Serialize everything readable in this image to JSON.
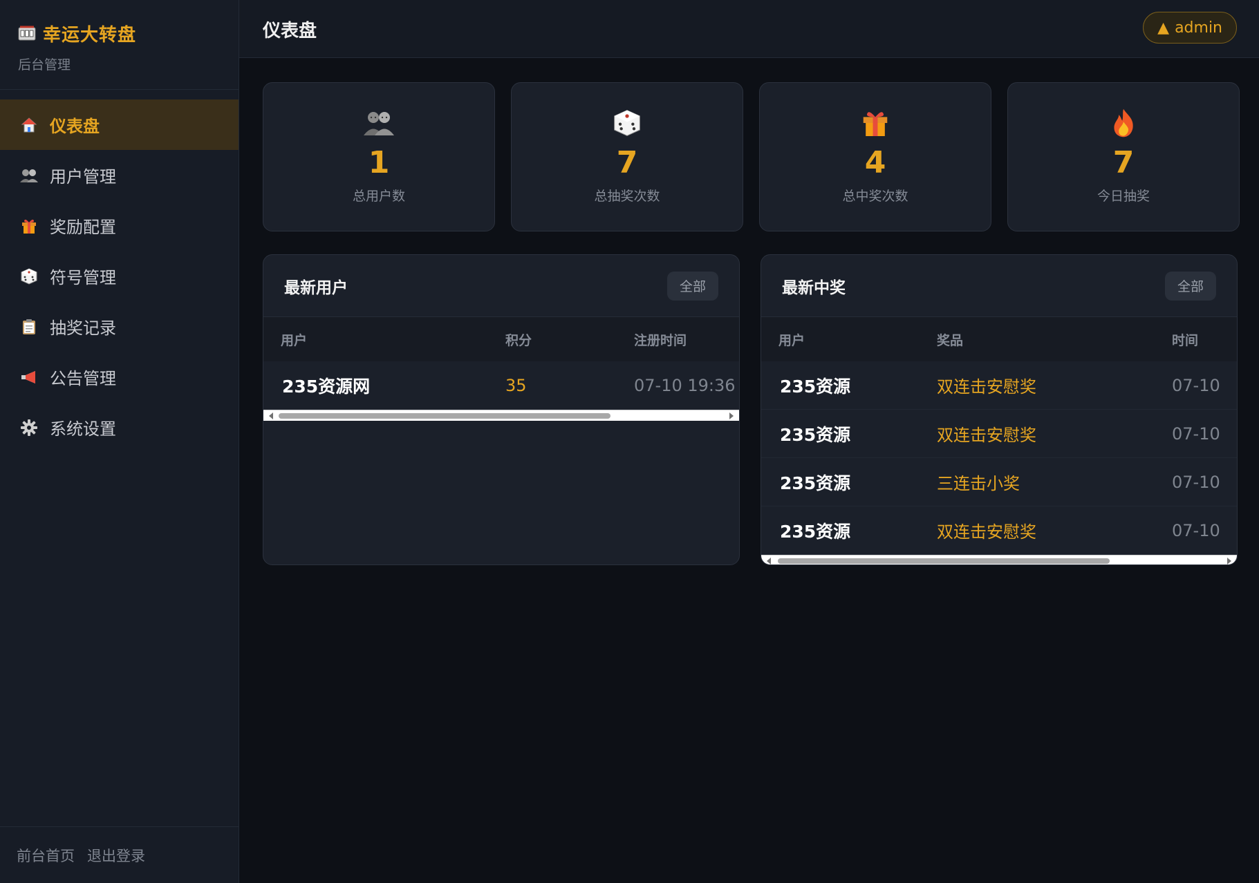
{
  "brand": {
    "title": "幸运大转盘",
    "subtitle": "后台管理",
    "icon": "slot-machine-icon"
  },
  "nav": {
    "items": [
      {
        "label": "仪表盘",
        "icon": "house-icon",
        "active": true
      },
      {
        "label": "用户管理",
        "icon": "users-icon"
      },
      {
        "label": "奖励配置",
        "icon": "gift-icon"
      },
      {
        "label": "符号管理",
        "icon": "dice-icon"
      },
      {
        "label": "抽奖记录",
        "icon": "clipboard-icon"
      },
      {
        "label": "公告管理",
        "icon": "megaphone-icon"
      },
      {
        "label": "系统设置",
        "icon": "gear-icon"
      }
    ]
  },
  "footer": {
    "home": "前台首页",
    "logout": "退出登录"
  },
  "header": {
    "title": "仪表盘",
    "user": "admin",
    "user_icon": "▲"
  },
  "stats": [
    {
      "value": "1",
      "label": "总用户数",
      "icon": "users-icon"
    },
    {
      "value": "7",
      "label": "总抽奖次数",
      "icon": "dice-icon"
    },
    {
      "value": "4",
      "label": "总中奖次数",
      "icon": "gift-icon"
    },
    {
      "value": "7",
      "label": "今日抽奖",
      "icon": "fire-icon"
    }
  ],
  "latest_users": {
    "title": "最新用户",
    "all_label": "全部",
    "columns": [
      "用户",
      "积分",
      "注册时间"
    ],
    "rows": [
      {
        "user": "235资源网",
        "points": "35",
        "time": "07-10 19:36"
      }
    ]
  },
  "latest_wins": {
    "title": "最新中奖",
    "all_label": "全部",
    "columns": [
      "用户",
      "奖品",
      "时间"
    ],
    "rows": [
      {
        "user": "235资源",
        "prize": "双连击安慰奖",
        "time": "07-10"
      },
      {
        "user": "235资源",
        "prize": "双连击安慰奖",
        "time": "07-10"
      },
      {
        "user": "235资源",
        "prize": "三连击小奖",
        "time": "07-10"
      },
      {
        "user": "235资源",
        "prize": "双连击安慰奖",
        "time": "07-10"
      }
    ]
  },
  "colors": {
    "accent": "#e6a521",
    "background": "#0d1016",
    "sidebar": "#171c26",
    "card": "#1b202a"
  }
}
